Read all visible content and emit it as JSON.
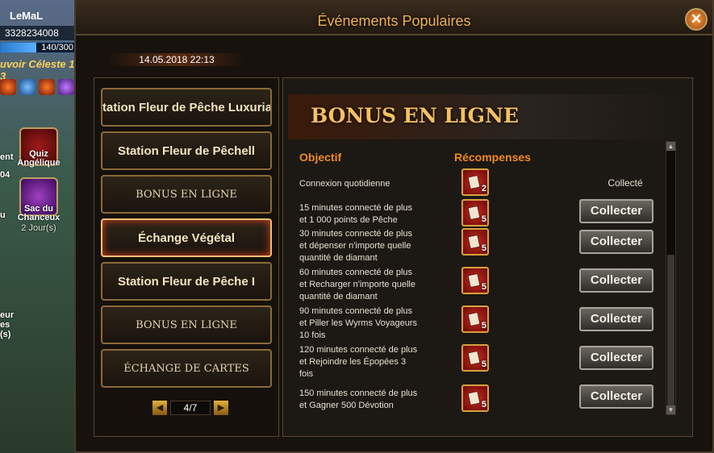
{
  "hud": {
    "player_name": "LeMaL",
    "gold": "3328234008",
    "energy": "140/300",
    "energy_fraction": 0.47,
    "title_text": "uvoir Céleste 1 3",
    "tiles": [
      {
        "label": "Quiz Angélique",
        "icon": "book-icon"
      },
      {
        "label": "Sac du Chanceux",
        "sub": "2 Jour(s)",
        "icon": "bag-icon"
      }
    ],
    "fragments": [
      "ent",
      "04",
      "u",
      "eur",
      "es",
      "(s)"
    ]
  },
  "window": {
    "title": "Événements Populaires",
    "date": "14.05.2018 22:13",
    "close_icon": "close-icon"
  },
  "events": [
    {
      "label": "tation Fleur de Pêche Luxuriante",
      "style": "sans"
    },
    {
      "label": "Station Fleur de Pêchell",
      "style": "sans"
    },
    {
      "label": "BONUS EN LIGNE",
      "style": "serif"
    },
    {
      "label": "Échange Végétal",
      "style": "sans",
      "active": true
    },
    {
      "label": "Station Fleur de Pêche I",
      "style": "sans"
    },
    {
      "label": "BONUS EN LIGNE",
      "style": "serif"
    },
    {
      "label": "ÉCHANGE DE CARTES",
      "style": "serif"
    }
  ],
  "pager": {
    "text": "4/7",
    "prev_icon": "arrow-left-icon",
    "next_icon": "arrow-right-icon"
  },
  "panel": {
    "banner_title": "BONUS EN LIGNE",
    "col_objective": "Objectif",
    "col_rewards": "Récompenses",
    "rows": [
      {
        "objective": "Connexion quotidienne",
        "qty": "2",
        "status": "Collecté"
      },
      {
        "objective": "15 minutes connecté de plus et 1 000 points de Pêche",
        "qty": "5",
        "status": "Collecter"
      },
      {
        "objective": "30 minutes connecté de plus et dépenser n'importe quelle quantité de diamant",
        "qty": "5",
        "status": "Collecter"
      },
      {
        "objective": "60 minutes connecté de plus et Recharger n'importe quelle quantité de diamant",
        "qty": "5",
        "status": "Collecter"
      },
      {
        "objective": "90 minutes connecté de plus et Piller les Wyrms Voyageurs 10 fois",
        "qty": "5",
        "status": "Collecter"
      },
      {
        "objective": "120 minutes connecté de plus et Rejoindre les Épopées 3 fois",
        "qty": "5",
        "status": "Collecter"
      },
      {
        "objective": "150 minutes connecté de plus et Gagner 500 Dévotion",
        "qty": "5",
        "status": "Collecter"
      }
    ]
  }
}
